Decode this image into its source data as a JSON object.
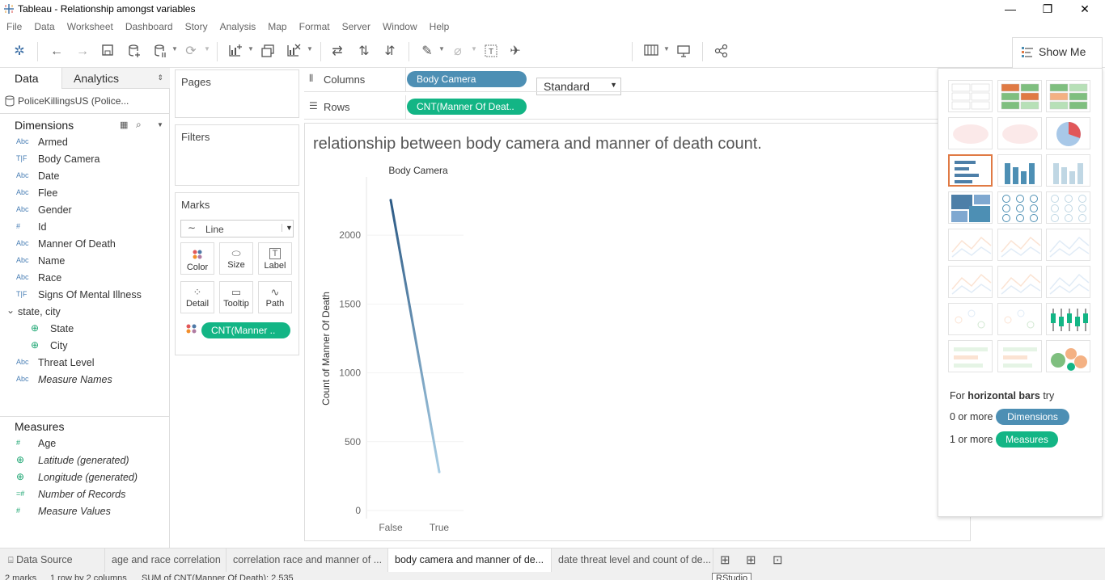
{
  "window": {
    "title": "Tableau - Relationship amongst variables",
    "minimize": "—",
    "restore": "❐",
    "close": "✕"
  },
  "menu": [
    "File",
    "Data",
    "Worksheet",
    "Dashboard",
    "Story",
    "Analysis",
    "Map",
    "Format",
    "Server",
    "Window",
    "Help"
  ],
  "toolbar": {
    "fit_mode": "Standard",
    "show_me_label": "Show Me"
  },
  "data_pane": {
    "tab_data": "Data",
    "tab_analytics": "Analytics",
    "datasource": "PoliceKillingsUS (Police...",
    "dimensions_header": "Dimensions",
    "dimensions": [
      {
        "type": "Abc",
        "name": "Armed"
      },
      {
        "type": "T|F",
        "name": "Body Camera"
      },
      {
        "type": "Abc",
        "name": "Date"
      },
      {
        "type": "Abc",
        "name": "Flee"
      },
      {
        "type": "Abc",
        "name": "Gender"
      },
      {
        "type": "#",
        "name": "Id"
      },
      {
        "type": "Abc",
        "name": "Manner Of Death"
      },
      {
        "type": "Abc",
        "name": "Name"
      },
      {
        "type": "Abc",
        "name": "Race"
      },
      {
        "type": "T|F",
        "name": "Signs Of Mental Illness"
      },
      {
        "type": "hier",
        "name": "state, city"
      },
      {
        "type": "geo",
        "name": "State"
      },
      {
        "type": "geo",
        "name": "City"
      },
      {
        "type": "Abc",
        "name": "Threat Level"
      },
      {
        "type": "Abc",
        "name": "Measure Names"
      }
    ],
    "measures_header": "Measures",
    "measures": [
      {
        "type": "#",
        "name": "Age"
      },
      {
        "type": "geo",
        "name": "Latitude (generated)"
      },
      {
        "type": "geo",
        "name": "Longitude (generated)"
      },
      {
        "type": "=#",
        "name": "Number of Records"
      },
      {
        "type": "#",
        "name": "Measure Values"
      }
    ]
  },
  "cards": {
    "pages": "Pages",
    "filters": "Filters",
    "marks": "Marks",
    "mark_type": "Line",
    "mark_buttons": [
      "Color",
      "Size",
      "Label",
      "Detail",
      "Tooltip",
      "Path"
    ],
    "mark_pill": "CNT(Manner .."
  },
  "shelves": {
    "columns_label": "Columns",
    "columns_pill": "Body Camera",
    "rows_label": "Rows",
    "rows_pill": "CNT(Manner Of Deat.."
  },
  "view": {
    "title": "relationship between body camera and manner of death count."
  },
  "chart_data": {
    "type": "line",
    "title": "Body Camera",
    "xlabel": "",
    "ylabel": "Count of Manner Of Death",
    "categories": [
      "False",
      "True"
    ],
    "values": [
      2255,
      280
    ],
    "ylim": [
      0,
      2400
    ],
    "yticks": [
      0,
      500,
      1000,
      1500,
      2000
    ],
    "grid": false,
    "colors": {
      "start": "#2c5a85",
      "end": "#a8cde4"
    }
  },
  "show_me": {
    "hint_prefix": "For",
    "hint_bold": "horizontal bars",
    "hint_suffix": "try",
    "row1_prefix": "0 or more",
    "row1_pill": "Dimensions",
    "row2_prefix": "1 or more",
    "row2_pill": "Measures",
    "colors": {
      "dimension": "#4d8fb4",
      "measure": "#13b585",
      "selected": "#e07a44"
    }
  },
  "sheet_tabs": [
    {
      "label": "Data Source",
      "active": false
    },
    {
      "label": "age and race correlation",
      "active": false
    },
    {
      "label": "correlation race and manner of ...",
      "active": false
    },
    {
      "label": "body camera and manner of de...",
      "active": true
    },
    {
      "label": "date threat level and count of de...",
      "active": false
    }
  ],
  "status": {
    "marks": "2 marks",
    "dims": "1 row by 2 columns",
    "sum": "SUM of CNT(Manner Of Death): 2,535",
    "tooltip": "RStudio"
  }
}
